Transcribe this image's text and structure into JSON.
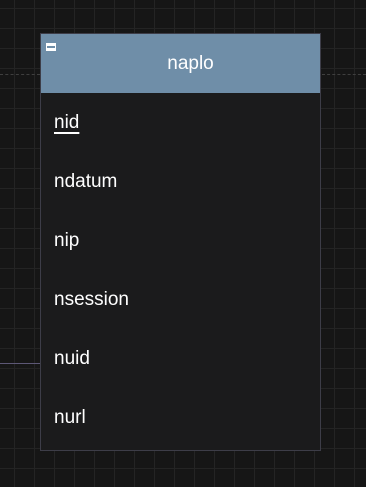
{
  "entity": {
    "name": "naplo",
    "collapse_icon": "minus-square-icon",
    "header_color": "#6f8ea8",
    "attributes": [
      {
        "name": "nid",
        "primary_key": true
      },
      {
        "name": "ndatum",
        "primary_key": false
      },
      {
        "name": "nip",
        "primary_key": false
      },
      {
        "name": "nsession",
        "primary_key": false
      },
      {
        "name": "nuid",
        "primary_key": false
      },
      {
        "name": "nurl",
        "primary_key": false
      }
    ]
  },
  "canvas": {
    "background": "#161616",
    "grid_color": "#242424",
    "relation_color": "#5d5876"
  }
}
